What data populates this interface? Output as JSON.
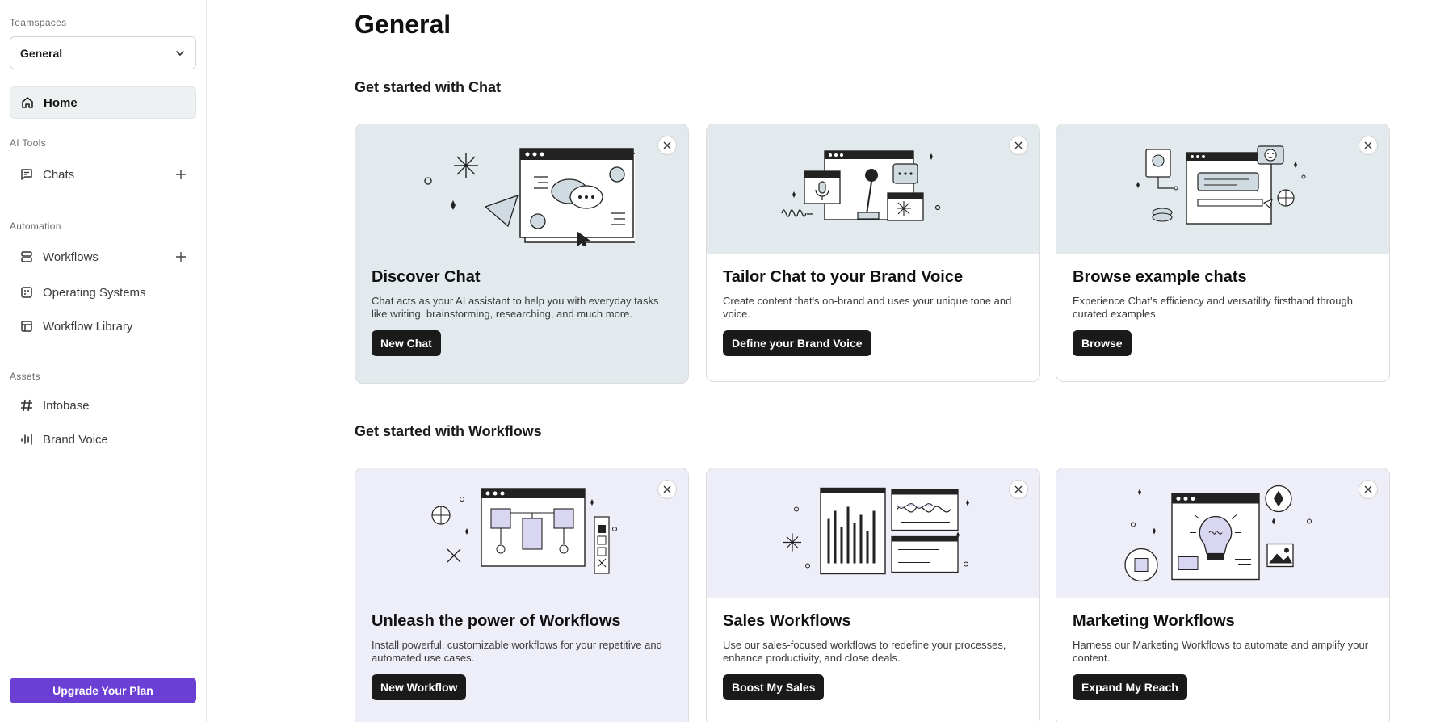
{
  "sidebar": {
    "teamspaces_label": "Teamspaces",
    "teamspace_selected": "General",
    "home_label": "Home",
    "ai_tools_label": "AI Tools",
    "chats_label": "Chats",
    "automation_label": "Automation",
    "workflows_label": "Workflows",
    "operating_systems_label": "Operating Systems",
    "workflow_library_label": "Workflow Library",
    "assets_label": "Assets",
    "infobase_label": "Infobase",
    "brand_voice_label": "Brand Voice",
    "upgrade_label": "Upgrade Your Plan"
  },
  "main": {
    "title": "General",
    "chat_section_title": "Get started with Chat",
    "workflows_section_title": "Get started with Workflows",
    "chat_cards": [
      {
        "title": "Discover Chat",
        "desc": "Chat acts as your AI assistant to help you with everyday tasks like writing, brainstorming, researching, and much more.",
        "button": "New Chat"
      },
      {
        "title": "Tailor Chat to your Brand Voice",
        "desc": "Create content that's on-brand and uses your unique tone and voice.",
        "button": "Define your Brand Voice"
      },
      {
        "title": "Browse example chats",
        "desc": "Experience Chat's efficiency and versatility firsthand through curated examples.",
        "button": "Browse"
      }
    ],
    "workflow_cards": [
      {
        "title": "Unleash the power of Workflows",
        "desc": "Install powerful, customizable workflows for your repetitive and automated use cases.",
        "button": "New Workflow"
      },
      {
        "title": "Sales Workflows",
        "desc": "Use our sales-focused workflows to redefine your processes, enhance productivity, and close deals.",
        "button": "Boost My Sales"
      },
      {
        "title": "Marketing Workflows",
        "desc": "Harness our Marketing Workflows to automate and amplify your content.",
        "button": "Expand My Reach"
      }
    ]
  },
  "colors": {
    "accent_purple": "#6b3fd4",
    "chat_card_bg": "#e3eaed",
    "workflow_card_bg": "#eeeef8",
    "dark_button": "#1a1a1a"
  }
}
